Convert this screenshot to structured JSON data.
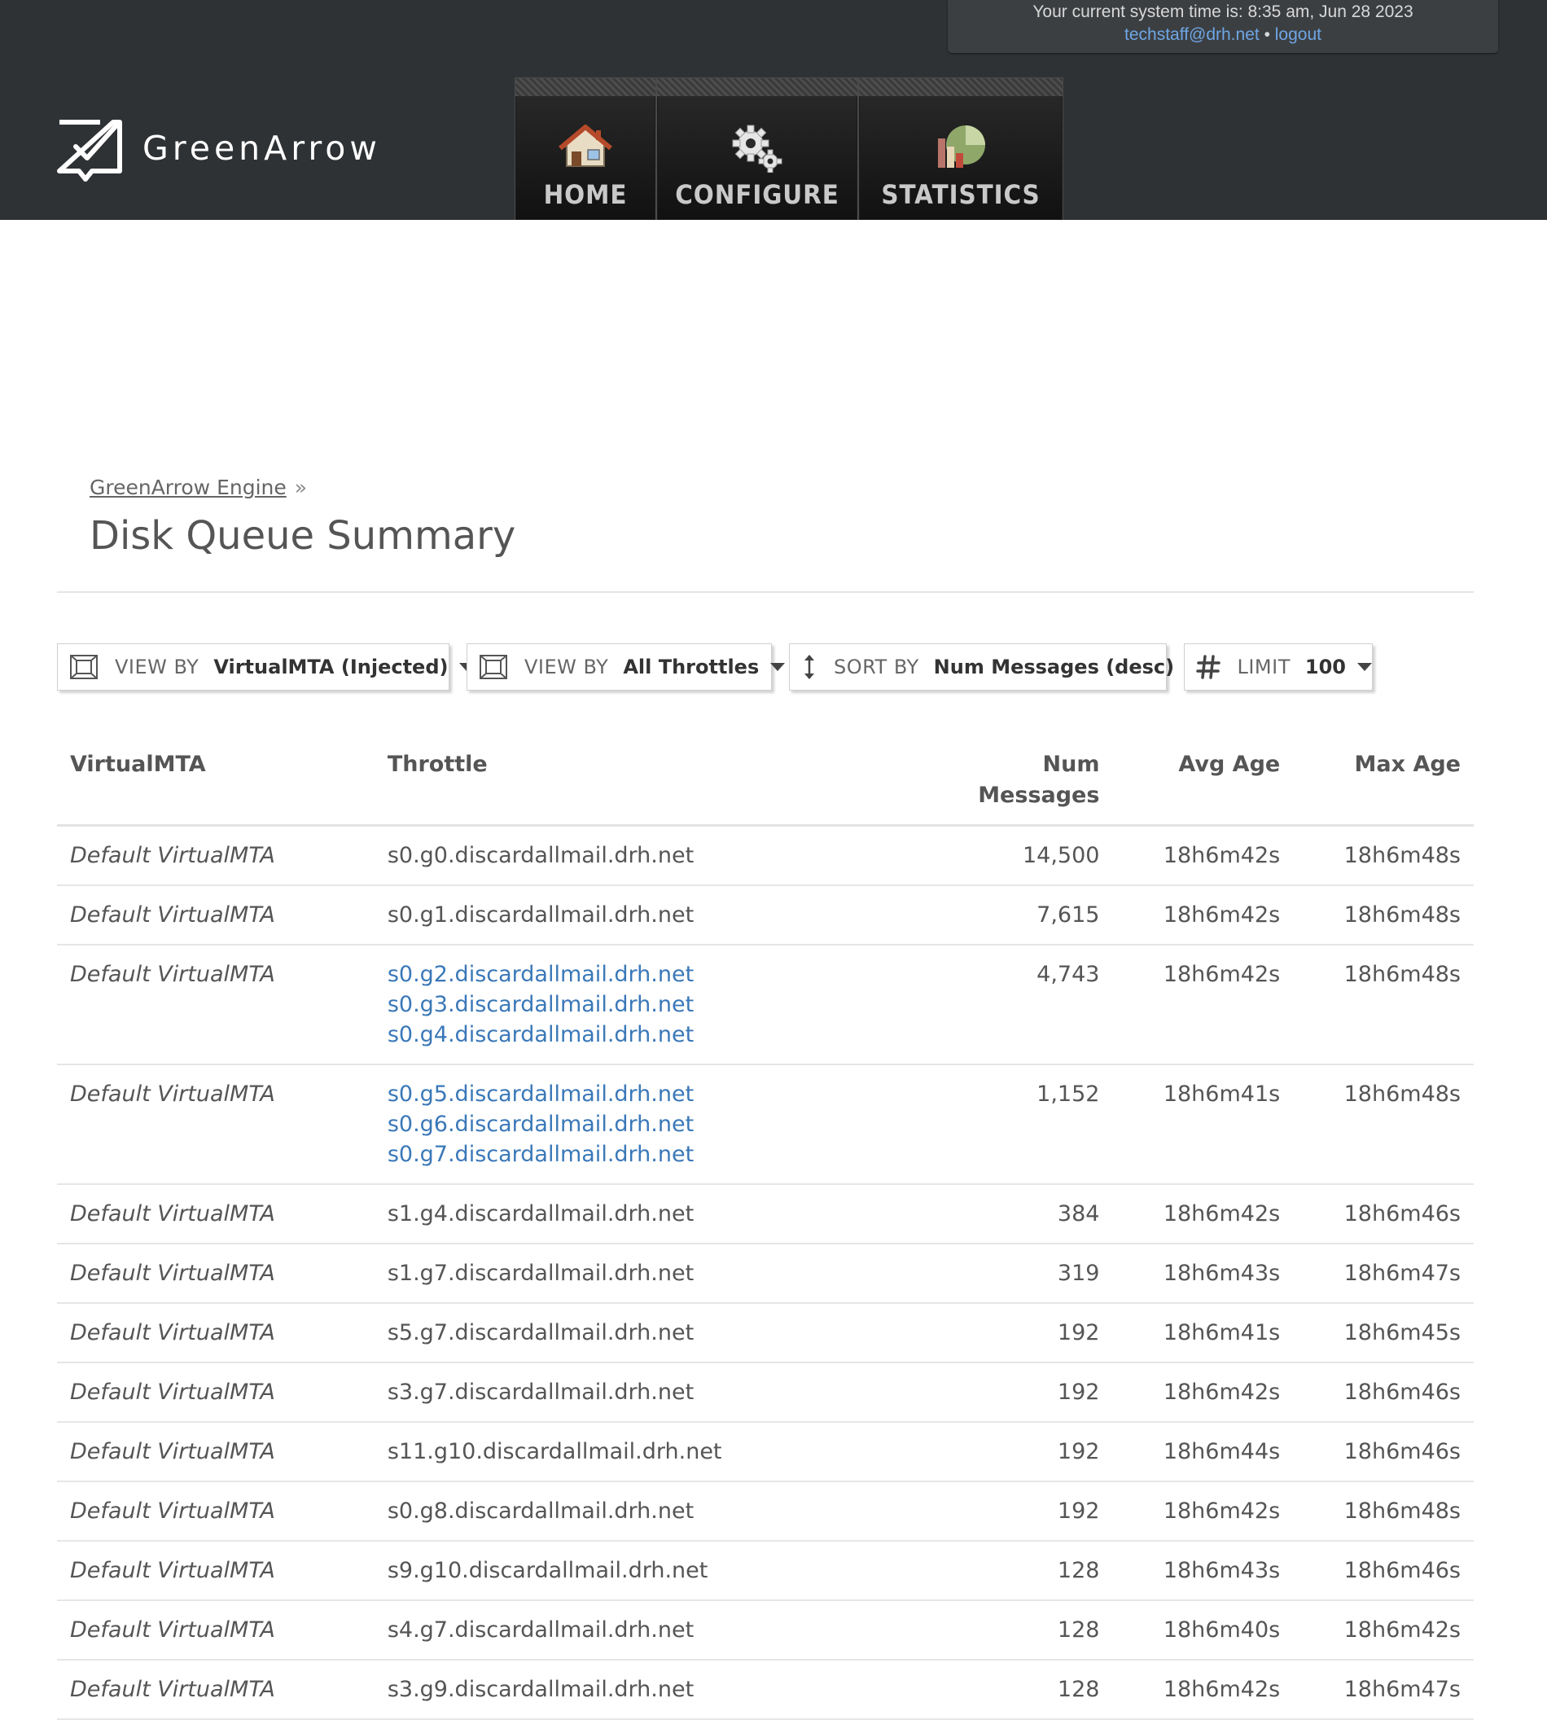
{
  "header": {
    "systime_prefix": "Your current system time is: 8:35 am, Jun 28 2023",
    "user_email": "techstaff@drh.net",
    "separator": "•",
    "logout_label": "logout",
    "logo_text": "GreenArrow",
    "nav": [
      {
        "label": "HOME",
        "icon": "house-icon"
      },
      {
        "label": "CONFIGURE",
        "icon": "gears-icon"
      },
      {
        "label": "STATISTICS",
        "icon": "chart-icon"
      }
    ]
  },
  "breadcrumb": {
    "parent": "GreenArrow Engine",
    "sep": "»"
  },
  "page_title": "Disk Queue Summary",
  "filters": [
    {
      "label": "VIEW BY",
      "value": "VirtualMTA (Injected)",
      "icon": "view-frame-icon"
    },
    {
      "label": "VIEW BY",
      "value": "All Throttles",
      "icon": "view-frame-icon"
    },
    {
      "label": "SORT BY",
      "value": "Num Messages (desc)",
      "icon": "sort-arrows-icon"
    },
    {
      "label": "LIMIT",
      "value": "100",
      "icon": "hash-icon"
    }
  ],
  "table": {
    "headers": {
      "vmta": "VirtualMTA",
      "throttle": "Throttle",
      "num_line1": "Num",
      "num_line2": "Messages",
      "avg": "Avg Age",
      "max": "Max Age"
    },
    "rows": [
      {
        "vmta": "Default VirtualMTA",
        "throttles": [
          "s0.g0.discardallmail.drh.net"
        ],
        "linked": false,
        "num": "14,500",
        "avg": "18h6m42s",
        "max": "18h6m48s"
      },
      {
        "vmta": "Default VirtualMTA",
        "throttles": [
          "s0.g1.discardallmail.drh.net"
        ],
        "linked": false,
        "num": "7,615",
        "avg": "18h6m42s",
        "max": "18h6m48s"
      },
      {
        "vmta": "Default VirtualMTA",
        "throttles": [
          "s0.g2.discardallmail.drh.net",
          "s0.g3.discardallmail.drh.net",
          "s0.g4.discardallmail.drh.net"
        ],
        "linked": true,
        "num": "4,743",
        "avg": "18h6m42s",
        "max": "18h6m48s"
      },
      {
        "vmta": "Default VirtualMTA",
        "throttles": [
          "s0.g5.discardallmail.drh.net",
          "s0.g6.discardallmail.drh.net",
          "s0.g7.discardallmail.drh.net"
        ],
        "linked": true,
        "num": "1,152",
        "avg": "18h6m41s",
        "max": "18h6m48s"
      },
      {
        "vmta": "Default VirtualMTA",
        "throttles": [
          "s1.g4.discardallmail.drh.net"
        ],
        "linked": false,
        "num": "384",
        "avg": "18h6m42s",
        "max": "18h6m46s"
      },
      {
        "vmta": "Default VirtualMTA",
        "throttles": [
          "s1.g7.discardallmail.drh.net"
        ],
        "linked": false,
        "num": "319",
        "avg": "18h6m43s",
        "max": "18h6m47s"
      },
      {
        "vmta": "Default VirtualMTA",
        "throttles": [
          "s5.g7.discardallmail.drh.net"
        ],
        "linked": false,
        "num": "192",
        "avg": "18h6m41s",
        "max": "18h6m45s"
      },
      {
        "vmta": "Default VirtualMTA",
        "throttles": [
          "s3.g7.discardallmail.drh.net"
        ],
        "linked": false,
        "num": "192",
        "avg": "18h6m42s",
        "max": "18h6m46s"
      },
      {
        "vmta": "Default VirtualMTA",
        "throttles": [
          "s11.g10.discardallmail.drh.net"
        ],
        "linked": false,
        "num": "192",
        "avg": "18h6m44s",
        "max": "18h6m46s"
      },
      {
        "vmta": "Default VirtualMTA",
        "throttles": [
          "s0.g8.discardallmail.drh.net"
        ],
        "linked": false,
        "num": "192",
        "avg": "18h6m42s",
        "max": "18h6m48s"
      },
      {
        "vmta": "Default VirtualMTA",
        "throttles": [
          "s9.g10.discardallmail.drh.net"
        ],
        "linked": false,
        "num": "128",
        "avg": "18h6m43s",
        "max": "18h6m46s"
      },
      {
        "vmta": "Default VirtualMTA",
        "throttles": [
          "s4.g7.discardallmail.drh.net"
        ],
        "linked": false,
        "num": "128",
        "avg": "18h6m40s",
        "max": "18h6m42s"
      },
      {
        "vmta": "Default VirtualMTA",
        "throttles": [
          "s3.g9.discardallmail.drh.net"
        ],
        "linked": false,
        "num": "128",
        "avg": "18h6m42s",
        "max": "18h6m47s"
      }
    ]
  }
}
